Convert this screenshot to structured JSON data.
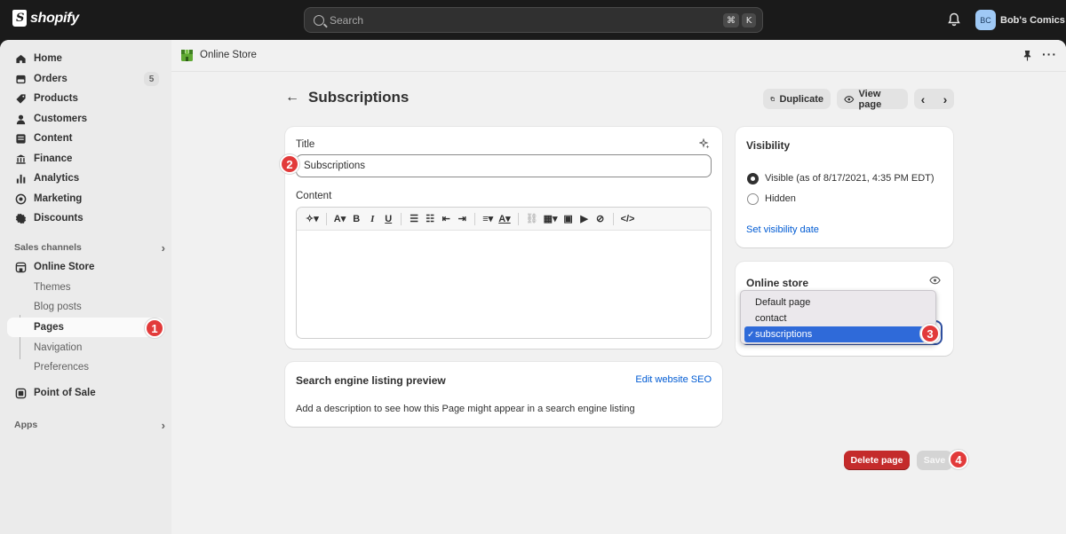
{
  "brand": {
    "name": "shopify"
  },
  "search": {
    "placeholder": "Search",
    "shortcut_cmd": "⌘",
    "shortcut_key": "K"
  },
  "account": {
    "initials": "BC",
    "name": "Bob's Comics",
    "avatar_color": "#9fc9f5"
  },
  "sidebar": {
    "items": [
      {
        "label": "Home",
        "icon": "home-icon"
      },
      {
        "label": "Orders",
        "icon": "orders-icon",
        "badge": "5"
      },
      {
        "label": "Products",
        "icon": "tag-icon"
      },
      {
        "label": "Customers",
        "icon": "person-icon"
      },
      {
        "label": "Content",
        "icon": "content-icon"
      },
      {
        "label": "Finance",
        "icon": "bank-icon"
      },
      {
        "label": "Analytics",
        "icon": "bar-chart-icon"
      },
      {
        "label": "Marketing",
        "icon": "target-icon"
      },
      {
        "label": "Discounts",
        "icon": "discount-icon"
      }
    ],
    "sales_channels_heading": "Sales channels",
    "online_store": "Online Store",
    "online_store_sub": [
      "Themes",
      "Blog posts",
      "Pages",
      "Navigation",
      "Preferences"
    ],
    "point_of_sale": "Point of Sale",
    "apps_heading": "Apps"
  },
  "subheader": {
    "title": "Online Store"
  },
  "page": {
    "title": "Subscriptions",
    "duplicate_label": "Duplicate",
    "view_page_label": "View page"
  },
  "editor": {
    "title_label": "Title",
    "title_value": "Subscriptions",
    "content_label": "Content"
  },
  "seo": {
    "heading": "Search engine listing preview",
    "edit_link": "Edit website SEO",
    "description": "Add a description to see how this Page might appear in a search engine listing"
  },
  "visibility": {
    "heading": "Visibility",
    "visible_label": "Visible (as of 8/17/2021, 4:35 PM EDT)",
    "hidden_label": "Hidden",
    "set_date_link": "Set visibility date"
  },
  "online_store_card": {
    "heading": "Online store",
    "template_options": [
      "Default page",
      "contact",
      "subscriptions"
    ],
    "selected": "subscriptions"
  },
  "actions": {
    "delete_label": "Delete page",
    "save_label": "Save"
  },
  "steps": [
    "1",
    "2",
    "3",
    "4"
  ],
  "colors": {
    "accent_link": "#005bd3",
    "delete": "#c42b2b",
    "step_badge": "#e23a3a",
    "selected_option": "#2f6ad9"
  }
}
